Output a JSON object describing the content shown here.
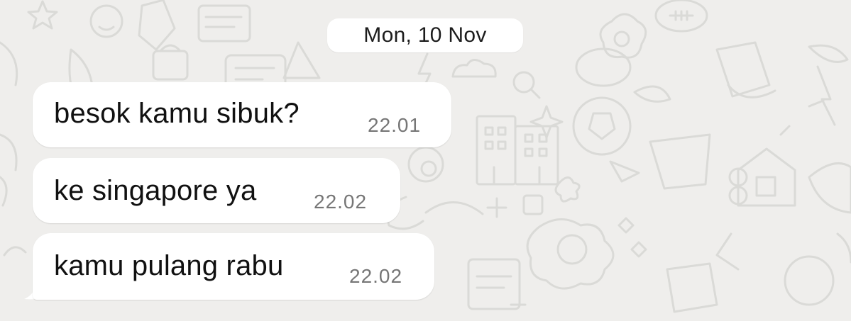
{
  "chat": {
    "date_label": "Mon, 10 Nov",
    "messages": [
      {
        "text": "besok kamu sibuk?",
        "time": "22.01"
      },
      {
        "text": "ke singapore ya",
        "time": "22.02"
      },
      {
        "text": "kamu pulang rabu",
        "time": "22.02"
      }
    ]
  },
  "theme": {
    "background": "#efeeec",
    "bubble": "#ffffff",
    "doodle": "#dadad7",
    "time_text": "#767676"
  },
  "wallpaper": {
    "icons": [
      "star-icon",
      "cloud-icon",
      "building-icon",
      "soccer-ball-icon",
      "flower-pot-icon",
      "house-icon",
      "lightning-icon",
      "plus-icon",
      "magnifier-icon",
      "banana-icon",
      "croissant-icon",
      "face-icon",
      "leaf-icon",
      "heart-icon",
      "triangle-icon",
      "bag-icon",
      "sparkle-icon",
      "paper-plane-icon"
    ]
  }
}
